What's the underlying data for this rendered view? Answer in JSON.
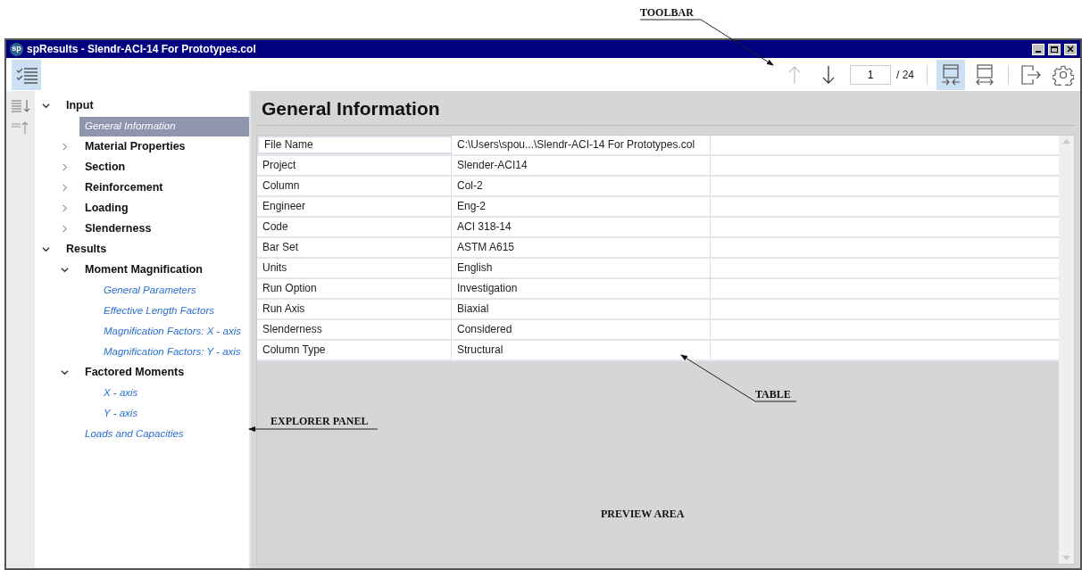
{
  "window": {
    "title": "spResults - Slendr-ACI-14 For Prototypes.col",
    "app_badge": "sp"
  },
  "toolbar": {
    "explorer_toggle_selected": true,
    "prev_disabled": true,
    "next_disabled": false,
    "page": "1",
    "total": "/ 24",
    "view_buttons": [
      {
        "kind": "collapse",
        "selected": true
      },
      {
        "kind": "expand",
        "selected": false
      }
    ]
  },
  "explorer": {
    "items": [
      {
        "label": "Input",
        "kind": "group",
        "expanded": true,
        "selected": false,
        "children": [
          {
            "label": "General Information",
            "kind": "page",
            "selected": true
          },
          {
            "label": "Material Properties",
            "kind": "section",
            "expanded": false,
            "selected": false
          },
          {
            "label": "Section",
            "kind": "section",
            "expanded": false,
            "selected": false
          },
          {
            "label": "Reinforcement",
            "kind": "section",
            "expanded": false,
            "selected": false
          },
          {
            "label": "Loading",
            "kind": "section",
            "expanded": false,
            "selected": false
          },
          {
            "label": "Slenderness",
            "kind": "section",
            "expanded": false,
            "selected": false
          }
        ]
      },
      {
        "label": "Results",
        "kind": "group",
        "expanded": true,
        "selected": false,
        "children": [
          {
            "label": "Moment Magnification",
            "kind": "section",
            "expanded": true,
            "selected": false,
            "children": [
              {
                "label": "General Parameters",
                "kind": "page",
                "selected": false
              },
              {
                "label": "Effective Length Factors",
                "kind": "page",
                "selected": false
              },
              {
                "label": "Magnification Factors: X - axis",
                "kind": "page",
                "selected": false
              },
              {
                "label": "Magnification Factors: Y - axis",
                "kind": "page",
                "selected": false
              }
            ]
          },
          {
            "label": "Factored Moments",
            "kind": "section",
            "expanded": true,
            "selected": false,
            "children": [
              {
                "label": "X - axis",
                "kind": "page",
                "selected": false
              },
              {
                "label": "Y - axis",
                "kind": "page",
                "selected": false
              }
            ]
          },
          {
            "label": "Loads and Capacities",
            "kind": "page",
            "selected": false
          }
        ]
      }
    ]
  },
  "content": {
    "title": "General Information",
    "table": {
      "rows": [
        {
          "label": "File Name",
          "value": "C:\\Users\\spou...\\Slendr-ACI-14 For Prototypes.col",
          "focused": true
        },
        {
          "label": "Project",
          "value": "Slender-ACI14",
          "focused": false
        },
        {
          "label": "Column",
          "value": "Col-2",
          "focused": false
        },
        {
          "label": "Engineer",
          "value": "Eng-2",
          "focused": false
        },
        {
          "label": "Code",
          "value": "ACI 318-14",
          "focused": false
        },
        {
          "label": "Bar Set",
          "value": "ASTM A615",
          "focused": false
        },
        {
          "label": "Units",
          "value": "English",
          "focused": false
        },
        {
          "label": "Run Option",
          "value": "Investigation",
          "focused": false
        },
        {
          "label": "Run Axis",
          "value": "Biaxial",
          "focused": false
        },
        {
          "label": "Slenderness",
          "value": "Considered",
          "focused": false
        },
        {
          "label": "Column Type",
          "value": "Structural",
          "focused": false
        }
      ]
    }
  },
  "callouts": [
    "TOOLBAR",
    "TABLE",
    "EXPLORER PANEL",
    "PREVIEW AREA"
  ]
}
